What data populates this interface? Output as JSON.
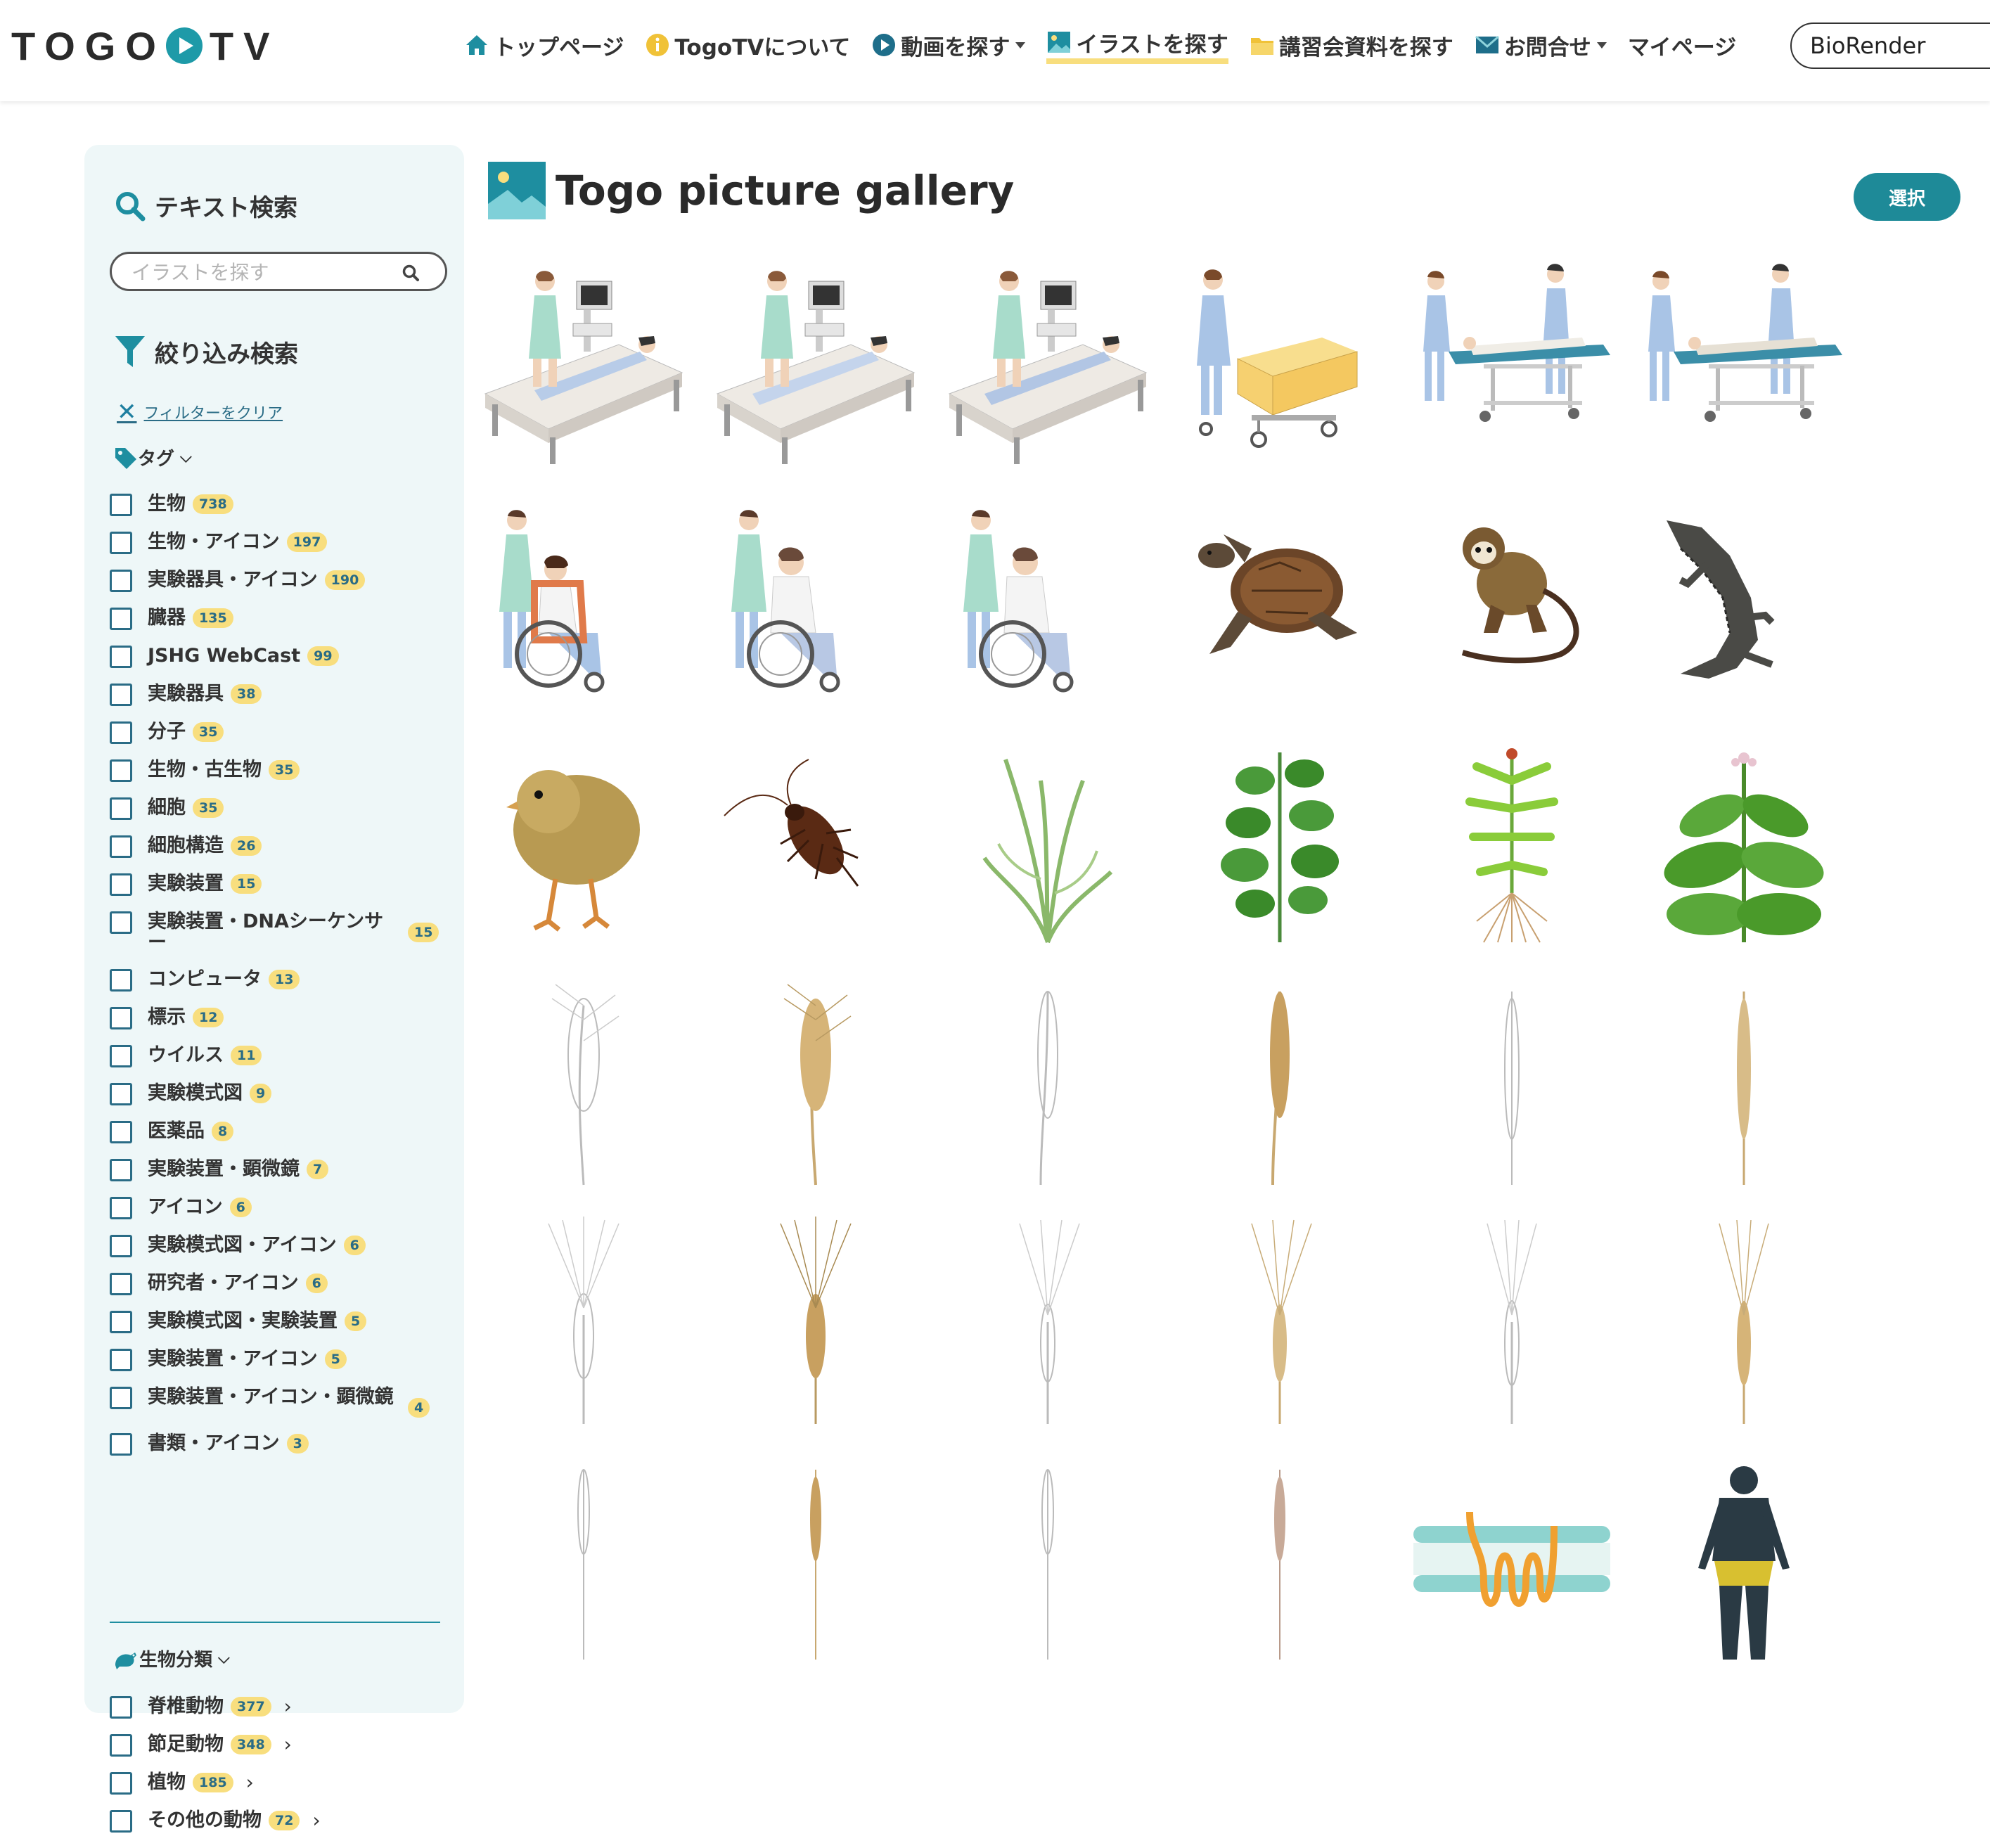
{
  "header": {
    "logo_text": "TOGO▶TV",
    "nav": [
      {
        "label": "トップページ",
        "icon": "home-icon"
      },
      {
        "label": "TogoTVについて",
        "icon": "info-icon"
      },
      {
        "label": "動画を探す",
        "icon": "play-icon"
      },
      {
        "label": "イラストを探す",
        "icon": "picture-icon"
      },
      {
        "label": "講習会資料を探す",
        "icon": "folder-icon"
      },
      {
        "label": "お問合せ",
        "icon": "mail-icon"
      },
      {
        "label": "マイページ"
      }
    ],
    "search_value": "BioRender"
  },
  "sidebar": {
    "text_search_title": "テキスト検索",
    "search_placeholder": "イラストを探す",
    "filter_title": "絞り込み検索",
    "clear_filter": "フィルターをクリア",
    "tag_head": "タグ",
    "tags": [
      {
        "label": "生物",
        "count": "738"
      },
      {
        "label": "生物・アイコン",
        "count": "197"
      },
      {
        "label": "実験器具・アイコン",
        "count": "190"
      },
      {
        "label": "臓器",
        "count": "135"
      },
      {
        "label": "JSHG WebCast",
        "count": "99"
      },
      {
        "label": "実験器具",
        "count": "38"
      },
      {
        "label": "分子",
        "count": "35"
      },
      {
        "label": "生物・古生物",
        "count": "35"
      },
      {
        "label": "細胞",
        "count": "35"
      },
      {
        "label": "細胞構造",
        "count": "26"
      },
      {
        "label": "実験装置",
        "count": "15"
      },
      {
        "label": "実験装置・DNAシーケンサー",
        "count": "15"
      },
      {
        "label": "コンピュータ",
        "count": "13"
      },
      {
        "label": "標示",
        "count": "12"
      },
      {
        "label": "ウイルス",
        "count": "11"
      },
      {
        "label": "実験模式図",
        "count": "9"
      },
      {
        "label": "医薬品",
        "count": "8"
      },
      {
        "label": "実験装置・顕微鏡",
        "count": "7"
      },
      {
        "label": "アイコン",
        "count": "6"
      },
      {
        "label": "実験模式図・アイコン",
        "count": "6"
      },
      {
        "label": "研究者・アイコン",
        "count": "6"
      },
      {
        "label": "実験模式図・実験装置",
        "count": "5"
      },
      {
        "label": "実験装置・アイコン",
        "count": "5"
      },
      {
        "label": "実験装置・アイコン・顕微鏡",
        "count": "4"
      },
      {
        "label": "書類・アイコン",
        "count": "3"
      }
    ],
    "category_head": "生物分類",
    "categories": [
      {
        "label": "脊椎動物",
        "count": "377"
      },
      {
        "label": "節足動物",
        "count": "348"
      },
      {
        "label": "植物",
        "count": "185"
      },
      {
        "label": "その他の動物",
        "count": "72"
      }
    ]
  },
  "main": {
    "title": "Togo picture gallery",
    "select_button": "選択",
    "items": [
      "ultrasound-exam-1",
      "ultrasound-exam-2",
      "ultrasound-exam-3",
      "nurse-with-baby-cot",
      "stretcher-transport-1",
      "stretcher-transport-2",
      "wheelchair-1",
      "wheelchair-2",
      "wheelchair-3",
      "sea-turtle",
      "squirrel-monkey",
      "crocodile",
      "chick",
      "cockroach",
      "grass-plant",
      "leafy-plant",
      "plant-with-roots",
      "tobacco-plant",
      "wheat-ear-outline-1",
      "wheat-ear-1",
      "wheat-ear-outline-2",
      "wheat-ear-2",
      "wheat-ear-outline-3",
      "wheat-ear-3",
      "barley-outline-1",
      "barley-1",
      "barley-outline-2",
      "barley-2",
      "barley-outline-3",
      "barley-3",
      "wheat-stalk-outline-1",
      "wheat-stalk-1",
      "wheat-stalk-outline-2",
      "wheat-stalk-2",
      "lipid-bilayer-membrane-protein",
      "human-body-back"
    ]
  }
}
